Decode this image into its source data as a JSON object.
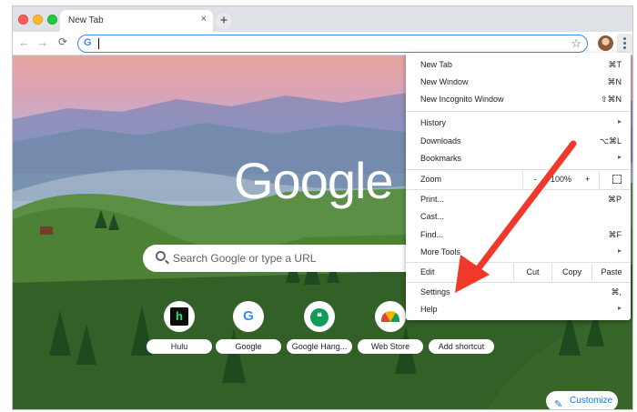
{
  "tab": {
    "title": "New Tab",
    "close": "×"
  },
  "toolbar": {
    "back": "←",
    "forward": "→",
    "reload": "C",
    "omnibox_placeholder": "",
    "omnibox_g": "G",
    "star": "☆",
    "new_tab": "+"
  },
  "page": {
    "logo": "Google",
    "search_placeholder": "Search Google or type a URL",
    "shortcuts": [
      {
        "label": "Hulu",
        "glyph": "h"
      },
      {
        "label": "Google",
        "glyph": "G"
      },
      {
        "label": "Google Hang...",
        "glyph": "❝"
      },
      {
        "label": "Web Store",
        "glyph": ""
      },
      {
        "label": "Add shortcut",
        "glyph": ""
      }
    ],
    "customize_label": "Customize",
    "pencil": "✎"
  },
  "menu": {
    "new_tab": {
      "label": "New Tab",
      "shortcut": "⌘T"
    },
    "new_window": {
      "label": "New Window",
      "shortcut": "⌘N"
    },
    "incognito": {
      "label": "New Incognito Window",
      "shortcut": "⇧⌘N"
    },
    "history": {
      "label": "History",
      "arrow": "▸"
    },
    "downloads": {
      "label": "Downloads",
      "shortcut": "⌥⌘L"
    },
    "bookmarks": {
      "label": "Bookmarks",
      "arrow": "▸"
    },
    "zoom": {
      "label": "Zoom",
      "minus": "-",
      "value": "100%",
      "plus": "+"
    },
    "print": {
      "label": "Print...",
      "shortcut": "⌘P"
    },
    "cast": {
      "label": "Cast..."
    },
    "find": {
      "label": "Find...",
      "shortcut": "⌘F"
    },
    "more_tools": {
      "label": "More Tools",
      "arrow": "▸"
    },
    "edit": {
      "label": "Edit",
      "cut": "Cut",
      "copy": "Copy",
      "paste": "Paste"
    },
    "settings": {
      "label": "Settings",
      "shortcut": "⌘,"
    },
    "help": {
      "label": "Help",
      "arrow": "▸"
    }
  },
  "colors": {
    "annotation_arrow": "#f0382b",
    "link_blue": "#1a73e8"
  }
}
